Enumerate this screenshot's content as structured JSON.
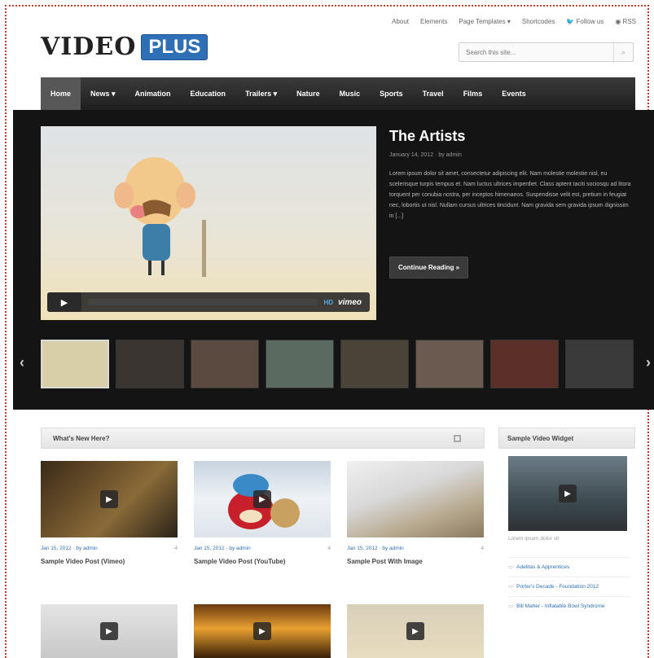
{
  "toplinks": [
    "About",
    "Elements",
    "Page Templates ▾",
    "Shortcodes",
    "Follow us",
    "RSS"
  ],
  "logo": {
    "word": "VIDEO",
    "badge": "PLUS"
  },
  "search": {
    "placeholder": "Search this site...",
    "icon": "search-icon"
  },
  "nav": [
    "Home",
    "News ▾",
    "Animation",
    "Education",
    "Trailers ▾",
    "Nature",
    "Music",
    "Sports",
    "Travel",
    "Films",
    "Events"
  ],
  "featured": {
    "title": "The Artists",
    "meta": "January 14, 2012 · by admin",
    "excerpt": "Lorem ipsum dolor sit amet, consectetur adipiscing elit. Nam molestie molestie nisl, eu scelerisque turpis tempus et. Nam luctus ultrices imperdiet. Class aptent taciti sociosqu ad litora torquent per conubia nostra, per inceptos himenaeos. Suspendisse velit est, pretium in feugiat nec, lobortis ut nisl. Nullam cursus ultrices tincidunt. Nam gravida sem gravida ipsum dignissim in [...]",
    "continue_label": "Continue Reading »",
    "player": {
      "play": "▶",
      "hd": "HD",
      "brand": "vimeo"
    }
  },
  "thumb_colors": [
    "#d8cfa8",
    "#3a3530",
    "#5a4a40",
    "#5a6a60",
    "#4a4438",
    "#6a5a50",
    "#5a3028",
    "#3a3a3a"
  ],
  "section": {
    "title": "What's New Here?"
  },
  "widget": {
    "title": "Sample Video Widget",
    "caption": "Lorem ipsum dolor sit",
    "links": [
      "Adelitas & Apprentices",
      "Porter's Decade - Foundation 2012",
      "Bill Maher - Inflatable Bowl Syndrome"
    ]
  },
  "posts": [
    {
      "date": "Jan 15, 2012",
      "author": "by admin",
      "comments": "4",
      "title": "Sample Video Post (Vimeo)"
    },
    {
      "date": "Jan 15, 2012",
      "author": "by admin",
      "comments": "4",
      "title": "Sample Video Post (YouTube)"
    },
    {
      "date": "Jan 15, 2012",
      "author": "by admin",
      "comments": "4",
      "title": "Sample Post With Image"
    }
  ]
}
